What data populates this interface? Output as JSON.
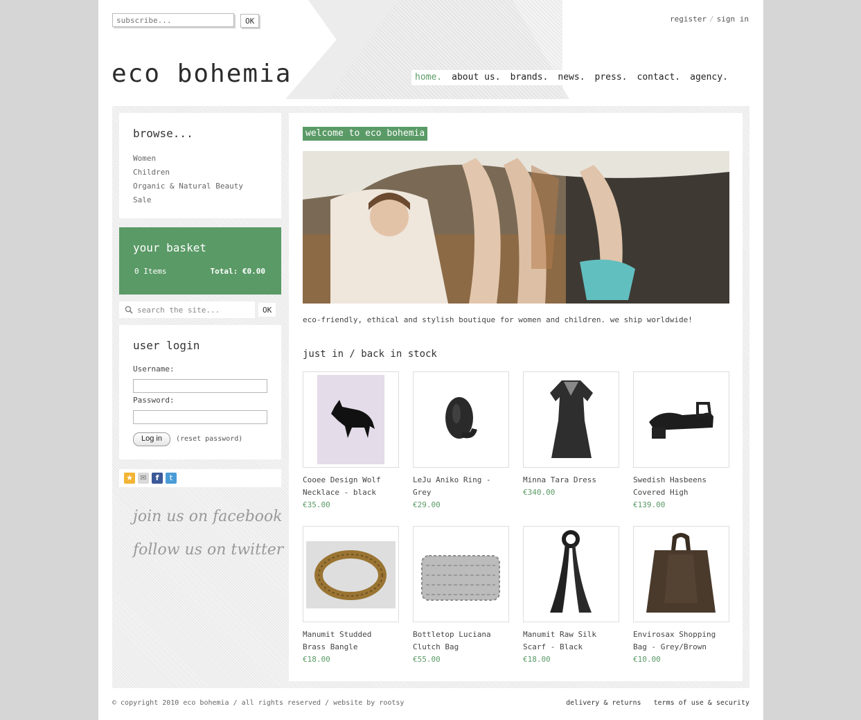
{
  "header": {
    "subscribe_placeholder": "subscribe...",
    "subscribe_ok": "OK",
    "register": "register",
    "separator": "/",
    "sign_in": "sign in",
    "logo": "eco bohemia"
  },
  "nav": {
    "items": [
      "home.",
      "about us.",
      "brands.",
      "news.",
      "press.",
      "contact.",
      "agency."
    ],
    "active_color": "#5a9a66"
  },
  "sidebar": {
    "browse_title": "browse...",
    "browse_items": [
      "Women",
      "Children",
      "Organic & Natural Beauty",
      "Sale"
    ],
    "basket_title": "your basket",
    "basket_count": "0 Items",
    "basket_total": "Total: €0.00",
    "search_placeholder": "search the site...",
    "search_ok": "OK",
    "login_title": "user login",
    "username_label": "Username:",
    "password_label": "Password:",
    "login_button": "Log in",
    "reset_password": "(reset password)",
    "social_icons": [
      "favorite-icon",
      "email-icon",
      "facebook-icon",
      "twitter-icon"
    ],
    "join_facebook": "join us on facebook",
    "follow_twitter": "follow us on twitter",
    "accent_color": "#5a9a66"
  },
  "main": {
    "welcome": "welcome to eco bohemia",
    "tagline": "eco-friendly, ethical and stylish boutique for women and children. we ship worldwide!",
    "just_in_title": "just in / back in stock",
    "products": [
      {
        "name": "Cooee Design Wolf Necklace - black",
        "price": "€35.00"
      },
      {
        "name": "LeJu Aniko Ring - Grey",
        "price": "€29.00"
      },
      {
        "name": "Minna Tara Dress",
        "price": "€340.00"
      },
      {
        "name": "Swedish Hasbeens Covered High",
        "price": "€139.00"
      },
      {
        "name": "Manumit Studded Brass Bangle",
        "price": "€18.00"
      },
      {
        "name": "Bottletop Luciana Clutch Bag",
        "price": "€55.00"
      },
      {
        "name": "Manumit Raw Silk Scarf - Black",
        "price": "€18.00"
      },
      {
        "name": "Envirosax Shopping Bag - Grey/Brown",
        "price": "€10.00"
      }
    ]
  },
  "footer": {
    "copyright": "© copyright 2010 eco bohemia / all rights reserved / website by rootsy",
    "delivery": "delivery & returns",
    "terms": "terms of use & security"
  }
}
